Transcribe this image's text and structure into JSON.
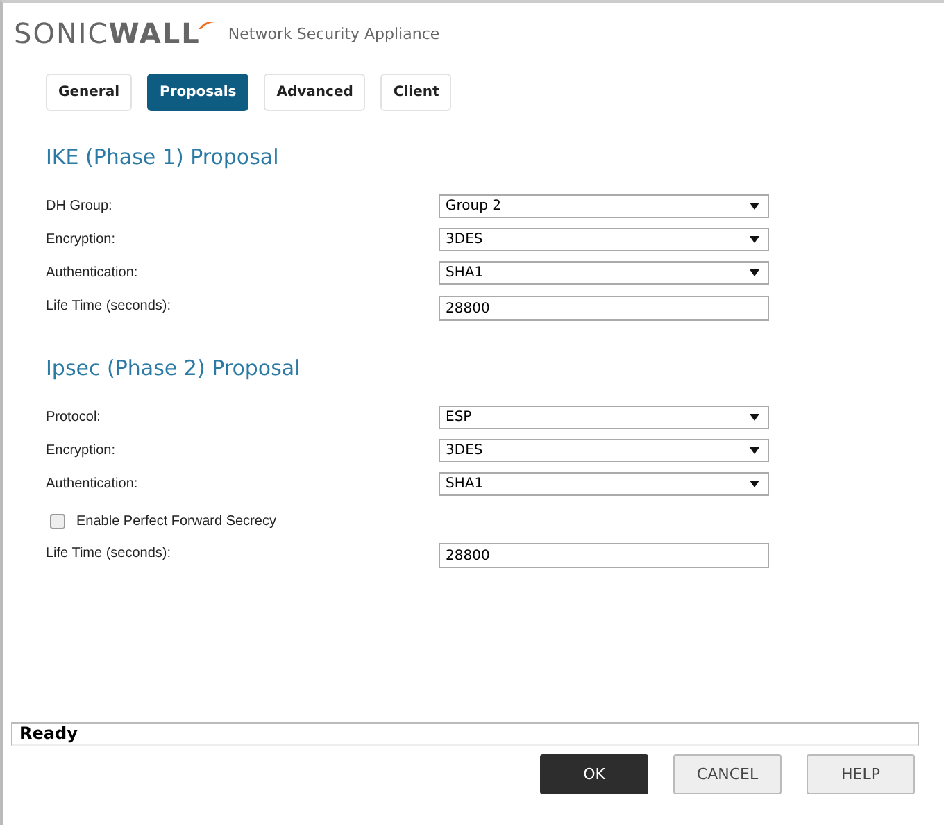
{
  "header": {
    "logo": "SONIC**WALL**",
    "product": "Network Security Appliance"
  },
  "tabs": [
    {
      "label": "General",
      "selected": false
    },
    {
      "label": "Proposals",
      "selected": true
    },
    {
      "label": "Advanced",
      "selected": false
    },
    {
      "label": "Client",
      "selected": false
    }
  ],
  "sections": [
    {
      "title": "IKE (Phase 1) Proposal",
      "fields": [
        {
          "kind": "select",
          "label": "DH Group:",
          "value": "Group 2"
        },
        {
          "kind": "select",
          "label": "Encryption:",
          "value": "3DES"
        },
        {
          "kind": "select",
          "label": "Authentication:",
          "value": "SHA1"
        },
        {
          "kind": "text",
          "label": "Life Time (seconds):",
          "value": "28800"
        }
      ]
    },
    {
      "title": "Ipsec (Phase 2) Proposal",
      "fields": [
        {
          "kind": "select",
          "label": "Protocol:",
          "value": "ESP"
        },
        {
          "kind": "select",
          "label": "Encryption:",
          "value": "3DES"
        },
        {
          "kind": "select",
          "label": "Authentication:",
          "value": "SHA1"
        },
        {
          "kind": "checkbox",
          "label": "Enable Perfect Forward Secrecy",
          "checked": false
        },
        {
          "kind": "text",
          "label": "Life Time (seconds):",
          "value": "28800"
        }
      ]
    }
  ],
  "status_bar": "Ready",
  "buttons": [
    {
      "label": "OK",
      "kind": "primary"
    },
    {
      "label": "CANCEL",
      "kind": "secondary"
    },
    {
      "label": "HELP",
      "kind": "secondary"
    }
  ]
}
